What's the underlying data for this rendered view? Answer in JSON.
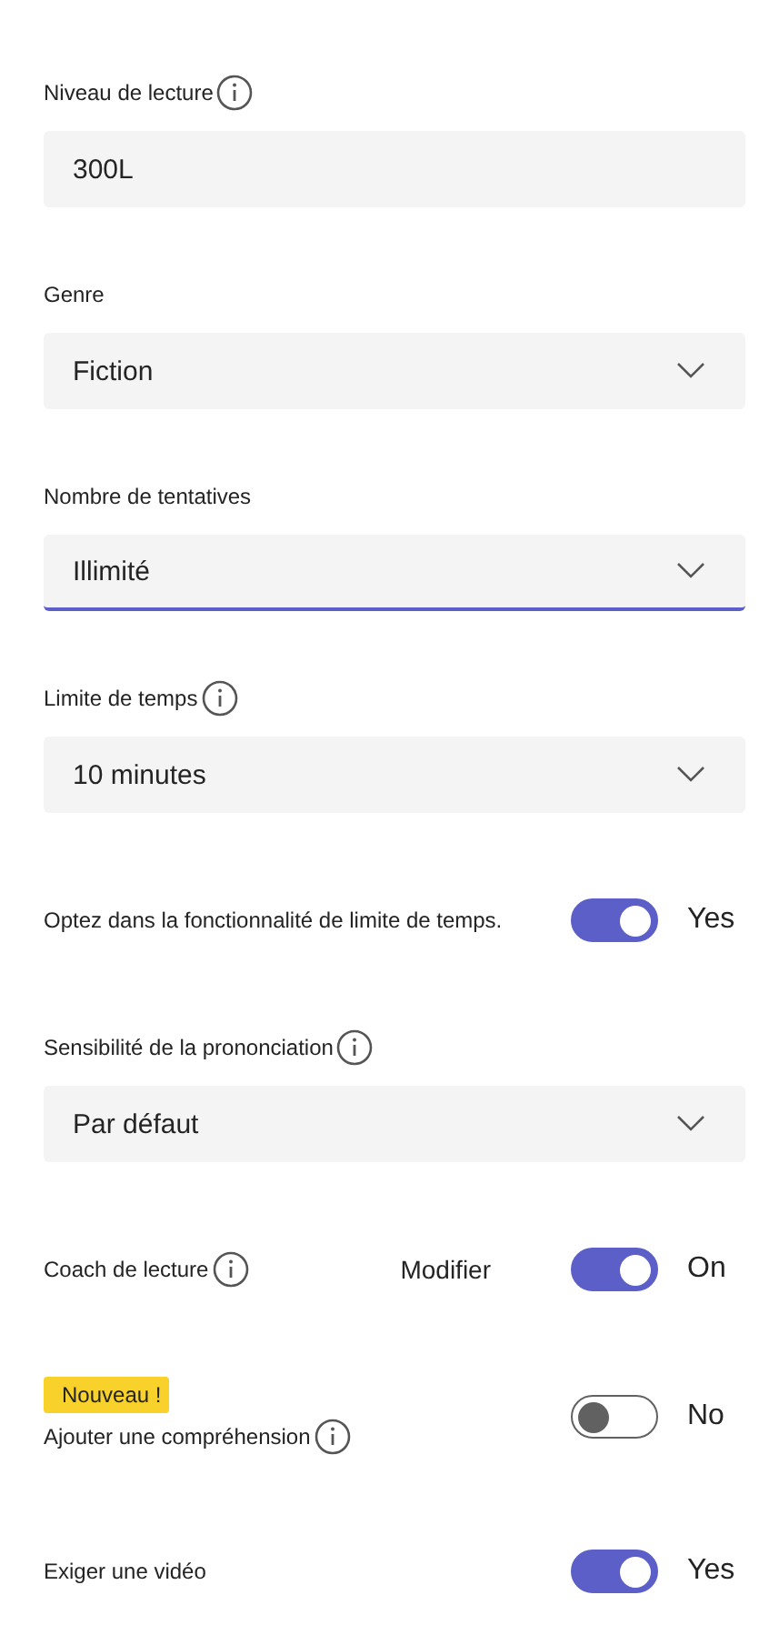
{
  "settings": [
    {
      "kind": "text",
      "label": "Niveau de lecture",
      "info": true,
      "value": "300L"
    },
    {
      "kind": "dropdown",
      "label": "Genre",
      "value": "Fiction",
      "focused": false
    },
    {
      "kind": "dropdown",
      "label": "Nombre de tentatives",
      "value": "Illimité",
      "focused": true
    },
    {
      "kind": "dropdown",
      "label": "Limite de temps",
      "info": true,
      "value": "10 minutes",
      "focused": false
    },
    {
      "kind": "toggle",
      "label": "Optez dans la fonctionnalité de limite de temps.",
      "on": true,
      "state_text": "Yes"
    },
    {
      "kind": "dropdown",
      "label": "Sensibilité de la prononciation",
      "info": true,
      "value": "Par défaut",
      "focused": false
    },
    {
      "kind": "toggle",
      "label": "Coach de lecture",
      "info": true,
      "link": "Modifier",
      "on": true,
      "state_text": "On"
    },
    {
      "kind": "toggle",
      "badge": "Nouveau !",
      "label": "Ajouter une compréhension",
      "info": true,
      "on": false,
      "state_text": "No"
    },
    {
      "kind": "toggle",
      "label": "Exiger une vidéo",
      "on": true,
      "state_text": "Yes"
    }
  ]
}
